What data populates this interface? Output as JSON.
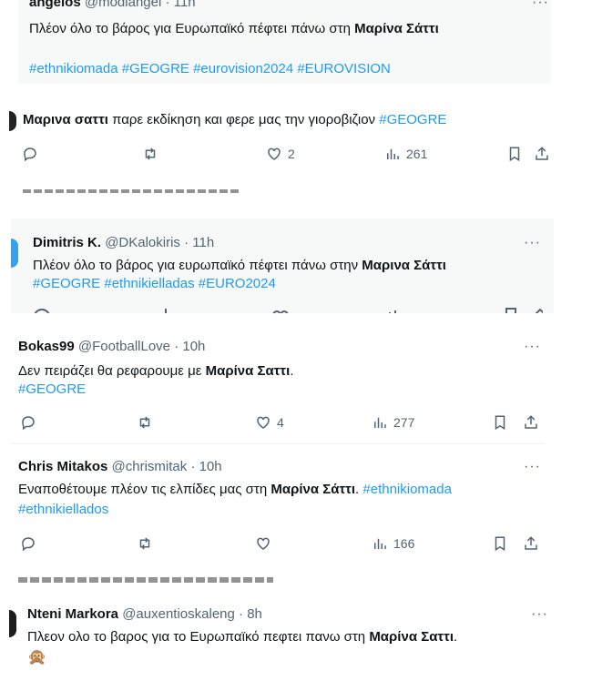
{
  "tweets": [
    {
      "name": "angelos",
      "handle": "@modiangel",
      "time": "11h",
      "text": "Πλέον όλο το βάρος για Ευρωπαϊκό πέφτει πάνω στη ",
      "bold": "Μαρίνα Σάττι",
      "hashtags": "#ethnikiomada #GEOGRE #eurovision2024 #EUROVISION"
    },
    {
      "bold_lead": "Μαρινα σαττι",
      "text": " παρε εκδίκηση και φερε μας την γιοροβιζιον ",
      "hashtag": "#GEOGRE",
      "likes": "2",
      "views": "261"
    },
    {
      "name": "Dimitris K.",
      "handle": "@DKalokiris",
      "time": "11h",
      "text": "Πλέον όλο το βάρος για ευρωπαϊκό πέφτει πάνω στην ",
      "bold": "Μαρινα Σάττι",
      "hashtags": "#GEOGRE #ethnikielladas #EURO2024"
    },
    {
      "name": "Bokas99",
      "handle": "@FootballLove",
      "time": "10h",
      "text": "Δεν πειράζει θα ρεφαρουμε με ",
      "bold": "Μαρίνα Σαττι",
      "text_end": ".",
      "hashtag": "#GEOGRE",
      "likes": "4",
      "views": "277"
    },
    {
      "name": "Chris Mitakos",
      "handle": "@chrismitak",
      "time": "10h",
      "text": "Εναποθέτουμε πλέον τις ελπίδες μας στη ",
      "bold": "Μαρίνα Σάττι",
      "text_end": ". ",
      "hashtag1": "#ethnikiomada",
      "hashtag2": "#ethnikiellados",
      "views": "166"
    },
    {
      "name": "Nteni Markora",
      "handle": "@auxentioskaleng",
      "time": "8h",
      "text": "Πλεον ολο το βαρος για το Ευρωπαϊκό πεφτει πανω στη ",
      "bold": "Μαρίνα Σαττι",
      "text_end": ".",
      "emoji": "🙊"
    }
  ],
  "ui": {
    "dot": "·",
    "more": "···",
    "accent": "#1d9bf0",
    "icons": [
      "reply-icon",
      "retweet-icon",
      "like-icon",
      "views-icon",
      "bookmark-icon",
      "share-icon"
    ]
  }
}
